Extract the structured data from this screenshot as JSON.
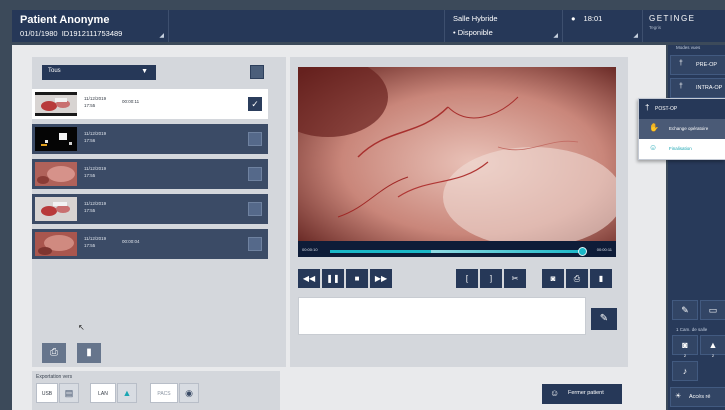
{
  "header": {
    "patient_name": "Patient Anonyme",
    "patient_dob": "01/01/1980",
    "patient_id": "ID1912111753489",
    "room_name": "Salle Hybride",
    "room_status": "Disponible",
    "time": "18:01",
    "brand": "GETINGE",
    "brand_sub": "Tegris",
    "room_bullet": "•",
    "clock_glyph": "●",
    "corner_glyph": "◢"
  },
  "library": {
    "filter_value": "Tous",
    "filter_chevron": "▼",
    "items": [
      {
        "date": "11/12/2019",
        "time": "17:55",
        "duration": "00:00:11",
        "selected": true,
        "check": "✓"
      },
      {
        "date": "11/12/2019",
        "time": "17:56",
        "duration": "",
        "selected": false,
        "check": ""
      },
      {
        "date": "11/12/2019",
        "time": "17:55",
        "duration": "",
        "selected": false,
        "check": ""
      },
      {
        "date": "11/12/2019",
        "time": "17:55",
        "duration": "",
        "selected": false,
        "check": ""
      },
      {
        "date": "11/12/2019",
        "time": "17:55",
        "duration": "00:00:04",
        "selected": false,
        "check": ""
      }
    ],
    "print_icon": "⎙",
    "delete_icon": "▮"
  },
  "export": {
    "label": "Exportation vers",
    "usb_label": "USB",
    "lan_label": "LAN",
    "pacs_label": "PACS",
    "usb_icon": "▤",
    "lan_icon": "▲",
    "pacs_icon": "◉"
  },
  "player": {
    "time_start": "00:00:10",
    "time_end": "00:00:11",
    "progress": 0.99,
    "buffered": 0.4,
    "controls": {
      "rewind": "◀◀",
      "pause": "❚❚",
      "stop": "■",
      "forward": "▶▶",
      "mark_in": "[",
      "mark_out": "]",
      "cut": "✂",
      "snapshot": "◙",
      "print": "⎙",
      "delete": "▮"
    },
    "edit_icon": "✎"
  },
  "footer": {
    "close_patient_label": "Fermer patient",
    "close_patient_icon": "☺"
  },
  "workflow": {
    "label": "Modes vues",
    "steps": [
      {
        "label": "PRE-OP",
        "icon": "†"
      },
      {
        "label": "INTRA-OP",
        "icon": "†"
      }
    ],
    "menu_header": "POST-OP",
    "menu_header_icon": "†",
    "menu_items": [
      {
        "label": "Echange opératoire",
        "icon": "✋"
      },
      {
        "label": "Finalisation",
        "icon": "☺"
      }
    ],
    "bottom": {
      "cam_label": "1 Cam. de salle",
      "access_label": "Accès ré",
      "icons": [
        "✎",
        "▭",
        "◙",
        "▲",
        "♪",
        "☀"
      ],
      "sub_a": "2",
      "sub_b": "2"
    }
  },
  "colors": {
    "navy": "#263858",
    "teal": "#1ab8c8",
    "panel": "#e9eaec",
    "frame": "#3c4a5a"
  }
}
